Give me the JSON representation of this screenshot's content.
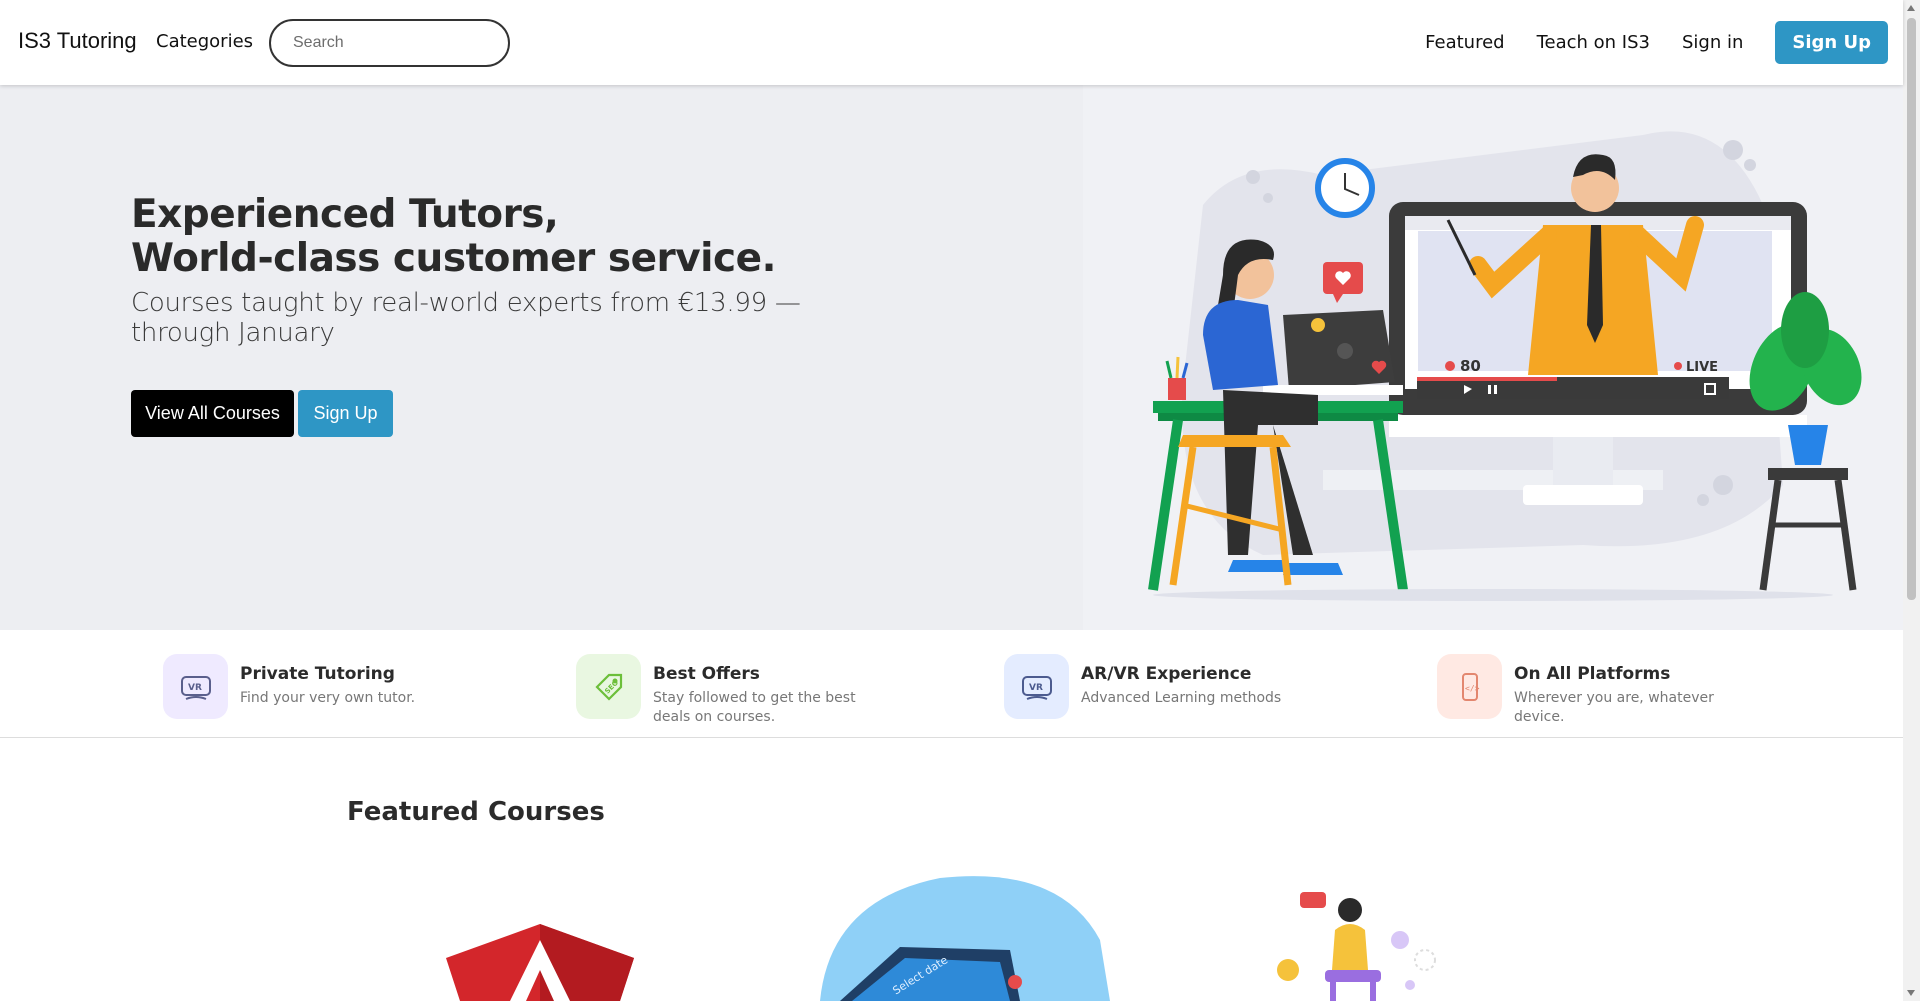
{
  "nav": {
    "brand": "IS3 Tutoring",
    "categories": "Categories",
    "search_placeholder": "Search",
    "links": [
      "Featured",
      "Teach on IS3",
      "Sign in"
    ],
    "signup": "Sign Up"
  },
  "hero": {
    "title_line1": "Experienced Tutors,",
    "title_line2": "World-class customer service.",
    "subtitle": "Courses taught by real-world experts from €13.99 — through January",
    "btn_courses": "View All Courses",
    "btn_signup": "Sign Up",
    "illustration": {
      "video_viewers": "80",
      "live_label": "LIVE"
    }
  },
  "features": [
    {
      "title": "Private Tutoring",
      "desc": "Find your very own tutor.",
      "icon": "vr-headset-icon",
      "color": "#efeaff"
    },
    {
      "title": "Best Offers",
      "desc": "Stay followed to get the best deals on courses.",
      "icon": "seo-tag-icon",
      "color": "#e9f7e1"
    },
    {
      "title": "AR/VR Experience",
      "desc": "Advanced Learning methods",
      "icon": "vr-headset-icon",
      "color": "#e4ecff"
    },
    {
      "title": "On All Platforms",
      "desc": "Wherever you are, whatever device.",
      "icon": "mobile-code-icon",
      "color": "#ffe9e3"
    }
  ],
  "featured": {
    "title": "Featured Courses",
    "thumb_text": "Select date"
  },
  "colors": {
    "accent": "#2e96c5",
    "hero_bg": "#edeef2",
    "dark_button": "#000000"
  }
}
